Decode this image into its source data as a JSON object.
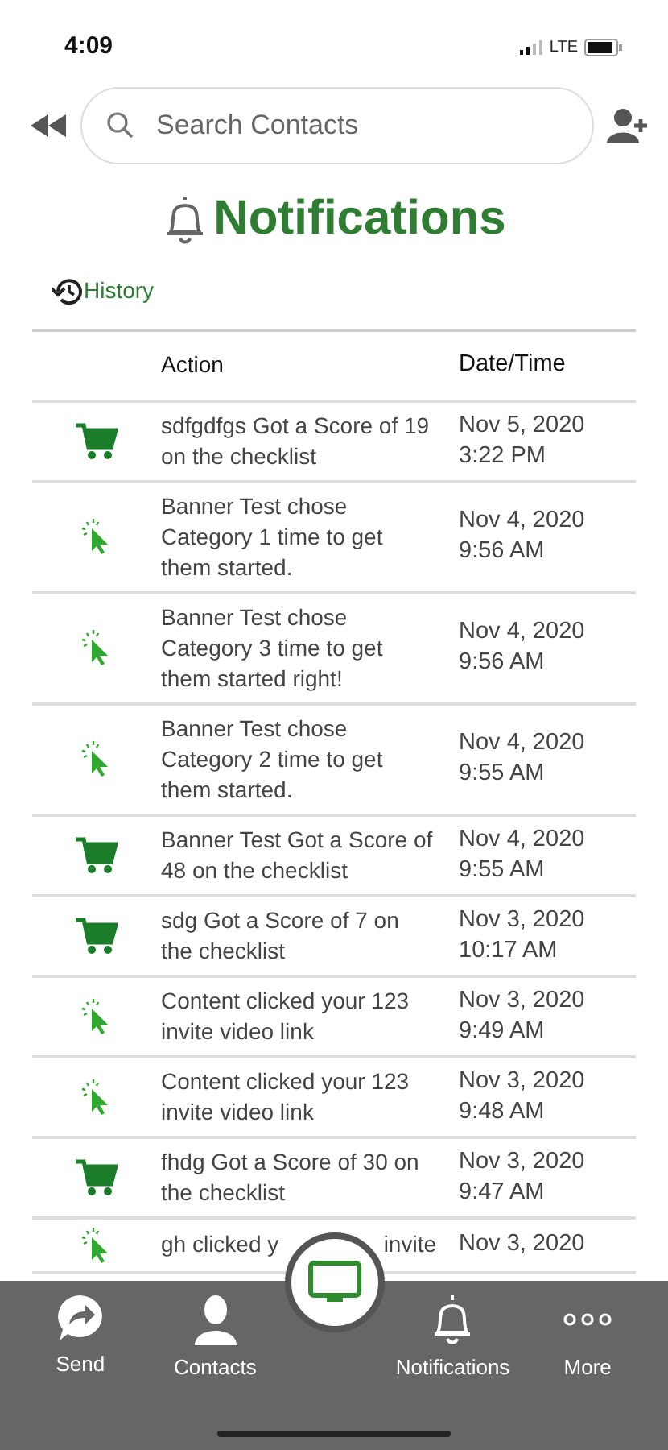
{
  "status_bar": {
    "time": "4:09",
    "network": "LTE"
  },
  "search": {
    "placeholder": "Search Contacts"
  },
  "title": "Notifications",
  "history_link": "History",
  "table": {
    "columns": [
      "Action",
      "Date/Time"
    ],
    "rows": [
      {
        "kind": "cart",
        "action": "sdfgdfgs  Got a Score of 19 on the checklist",
        "date": "Nov 5, 2020",
        "time": "3:22 PM"
      },
      {
        "kind": "click",
        "action": "Banner Test chose Category 1 time to get them started.",
        "date": "Nov 4, 2020",
        "time": "9:56 AM"
      },
      {
        "kind": "click",
        "action": "Banner Test  chose Category 3 time to get them started right!",
        "date": "Nov 4, 2020",
        "time": "9:56 AM"
      },
      {
        "kind": "click",
        "action": "Banner Test chose Category 2 time to get them started.",
        "date": "Nov 4, 2020",
        "time": "9:55 AM"
      },
      {
        "kind": "cart",
        "action": "Banner Test Got a Score of 48 on the checklist",
        "date": "Nov 4, 2020",
        "time": "9:55 AM"
      },
      {
        "kind": "cart",
        "action": "sdg  Got a Score of 7 on the checklist",
        "date": "Nov 3, 2020",
        "time": "10:17 AM"
      },
      {
        "kind": "click",
        "action": "Content clicked your 123 invite video link",
        "date": "Nov 3, 2020",
        "time": "9:49 AM"
      },
      {
        "kind": "click",
        "action": "Content clicked your 123 invite video link",
        "date": "Nov 3, 2020",
        "time": "9:48 AM"
      },
      {
        "kind": "cart",
        "action": "fhdg  Got a Score of 30 on the checklist",
        "date": "Nov 3, 2020",
        "time": "9:47 AM"
      },
      {
        "kind": "click",
        "action_parts": [
          "gh clicked y",
          "invite"
        ],
        "date": "Nov 3, 2020"
      }
    ]
  },
  "tab_bar": [
    {
      "kind": "send",
      "label": "Send"
    },
    {
      "kind": "contacts",
      "label": "Contacts"
    },
    {
      "kind": "center"
    },
    {
      "kind": "bell",
      "label": "Notifications"
    },
    {
      "kind": "more",
      "label": "More"
    }
  ]
}
